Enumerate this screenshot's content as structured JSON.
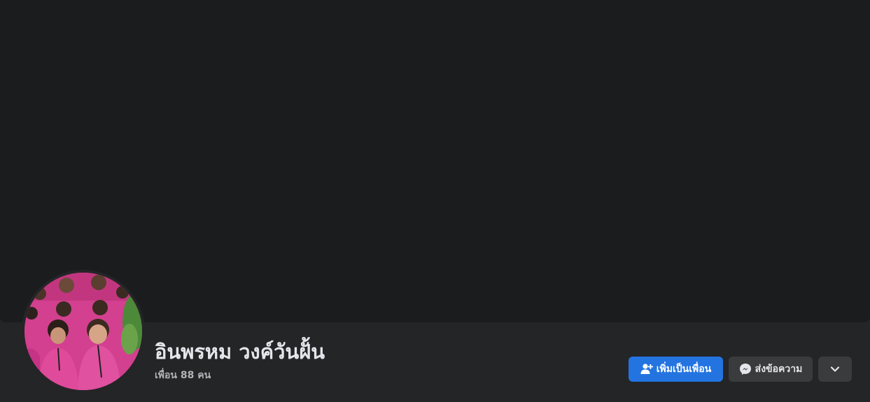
{
  "profile": {
    "name": "อินพรหม วงค์วันฝั้น",
    "friends_text": "เพื่อน 88 คน"
  },
  "actions": {
    "add_friend_label": "เพิ่มเป็นเพื่อน",
    "message_label": "ส่งข้อความ"
  },
  "icons": {
    "add_friend": "add-friend-icon",
    "messenger": "messenger-icon",
    "more": "chevron-down-icon"
  },
  "colors": {
    "primary_button": "#2374e1",
    "secondary_button": "#3a3b3c",
    "cover_background": "#1b1c1e",
    "page_background": "#242526",
    "name_text": "#e4e6eb",
    "secondary_text": "#b0b3b8"
  }
}
